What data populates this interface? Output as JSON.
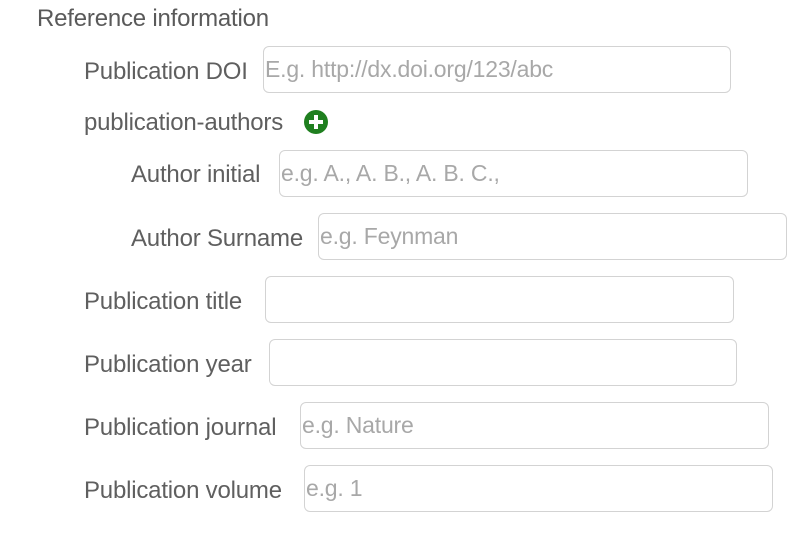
{
  "section": {
    "title": "Reference information"
  },
  "doi": {
    "label": "Publication DOI",
    "placeholder": "E.g. http://dx.doi.org/123/abc",
    "value": ""
  },
  "authors": {
    "label": "publication-authors",
    "add_icon": "plus-circle-icon",
    "add_color": "#1f7f1f",
    "initial": {
      "label": "Author initial",
      "placeholder": "e.g. A., A. B., A. B. C.,",
      "value": ""
    },
    "surname": {
      "label": "Author Surname",
      "placeholder": "e.g. Feynman",
      "value": ""
    }
  },
  "title": {
    "label": "Publication title",
    "placeholder": "",
    "value": ""
  },
  "year": {
    "label": "Publication year",
    "placeholder": "",
    "value": ""
  },
  "journal": {
    "label": "Publication journal",
    "placeholder": "e.g. Nature",
    "value": ""
  },
  "volume": {
    "label": "Publication volume",
    "placeholder": "e.g. 1",
    "value": ""
  }
}
